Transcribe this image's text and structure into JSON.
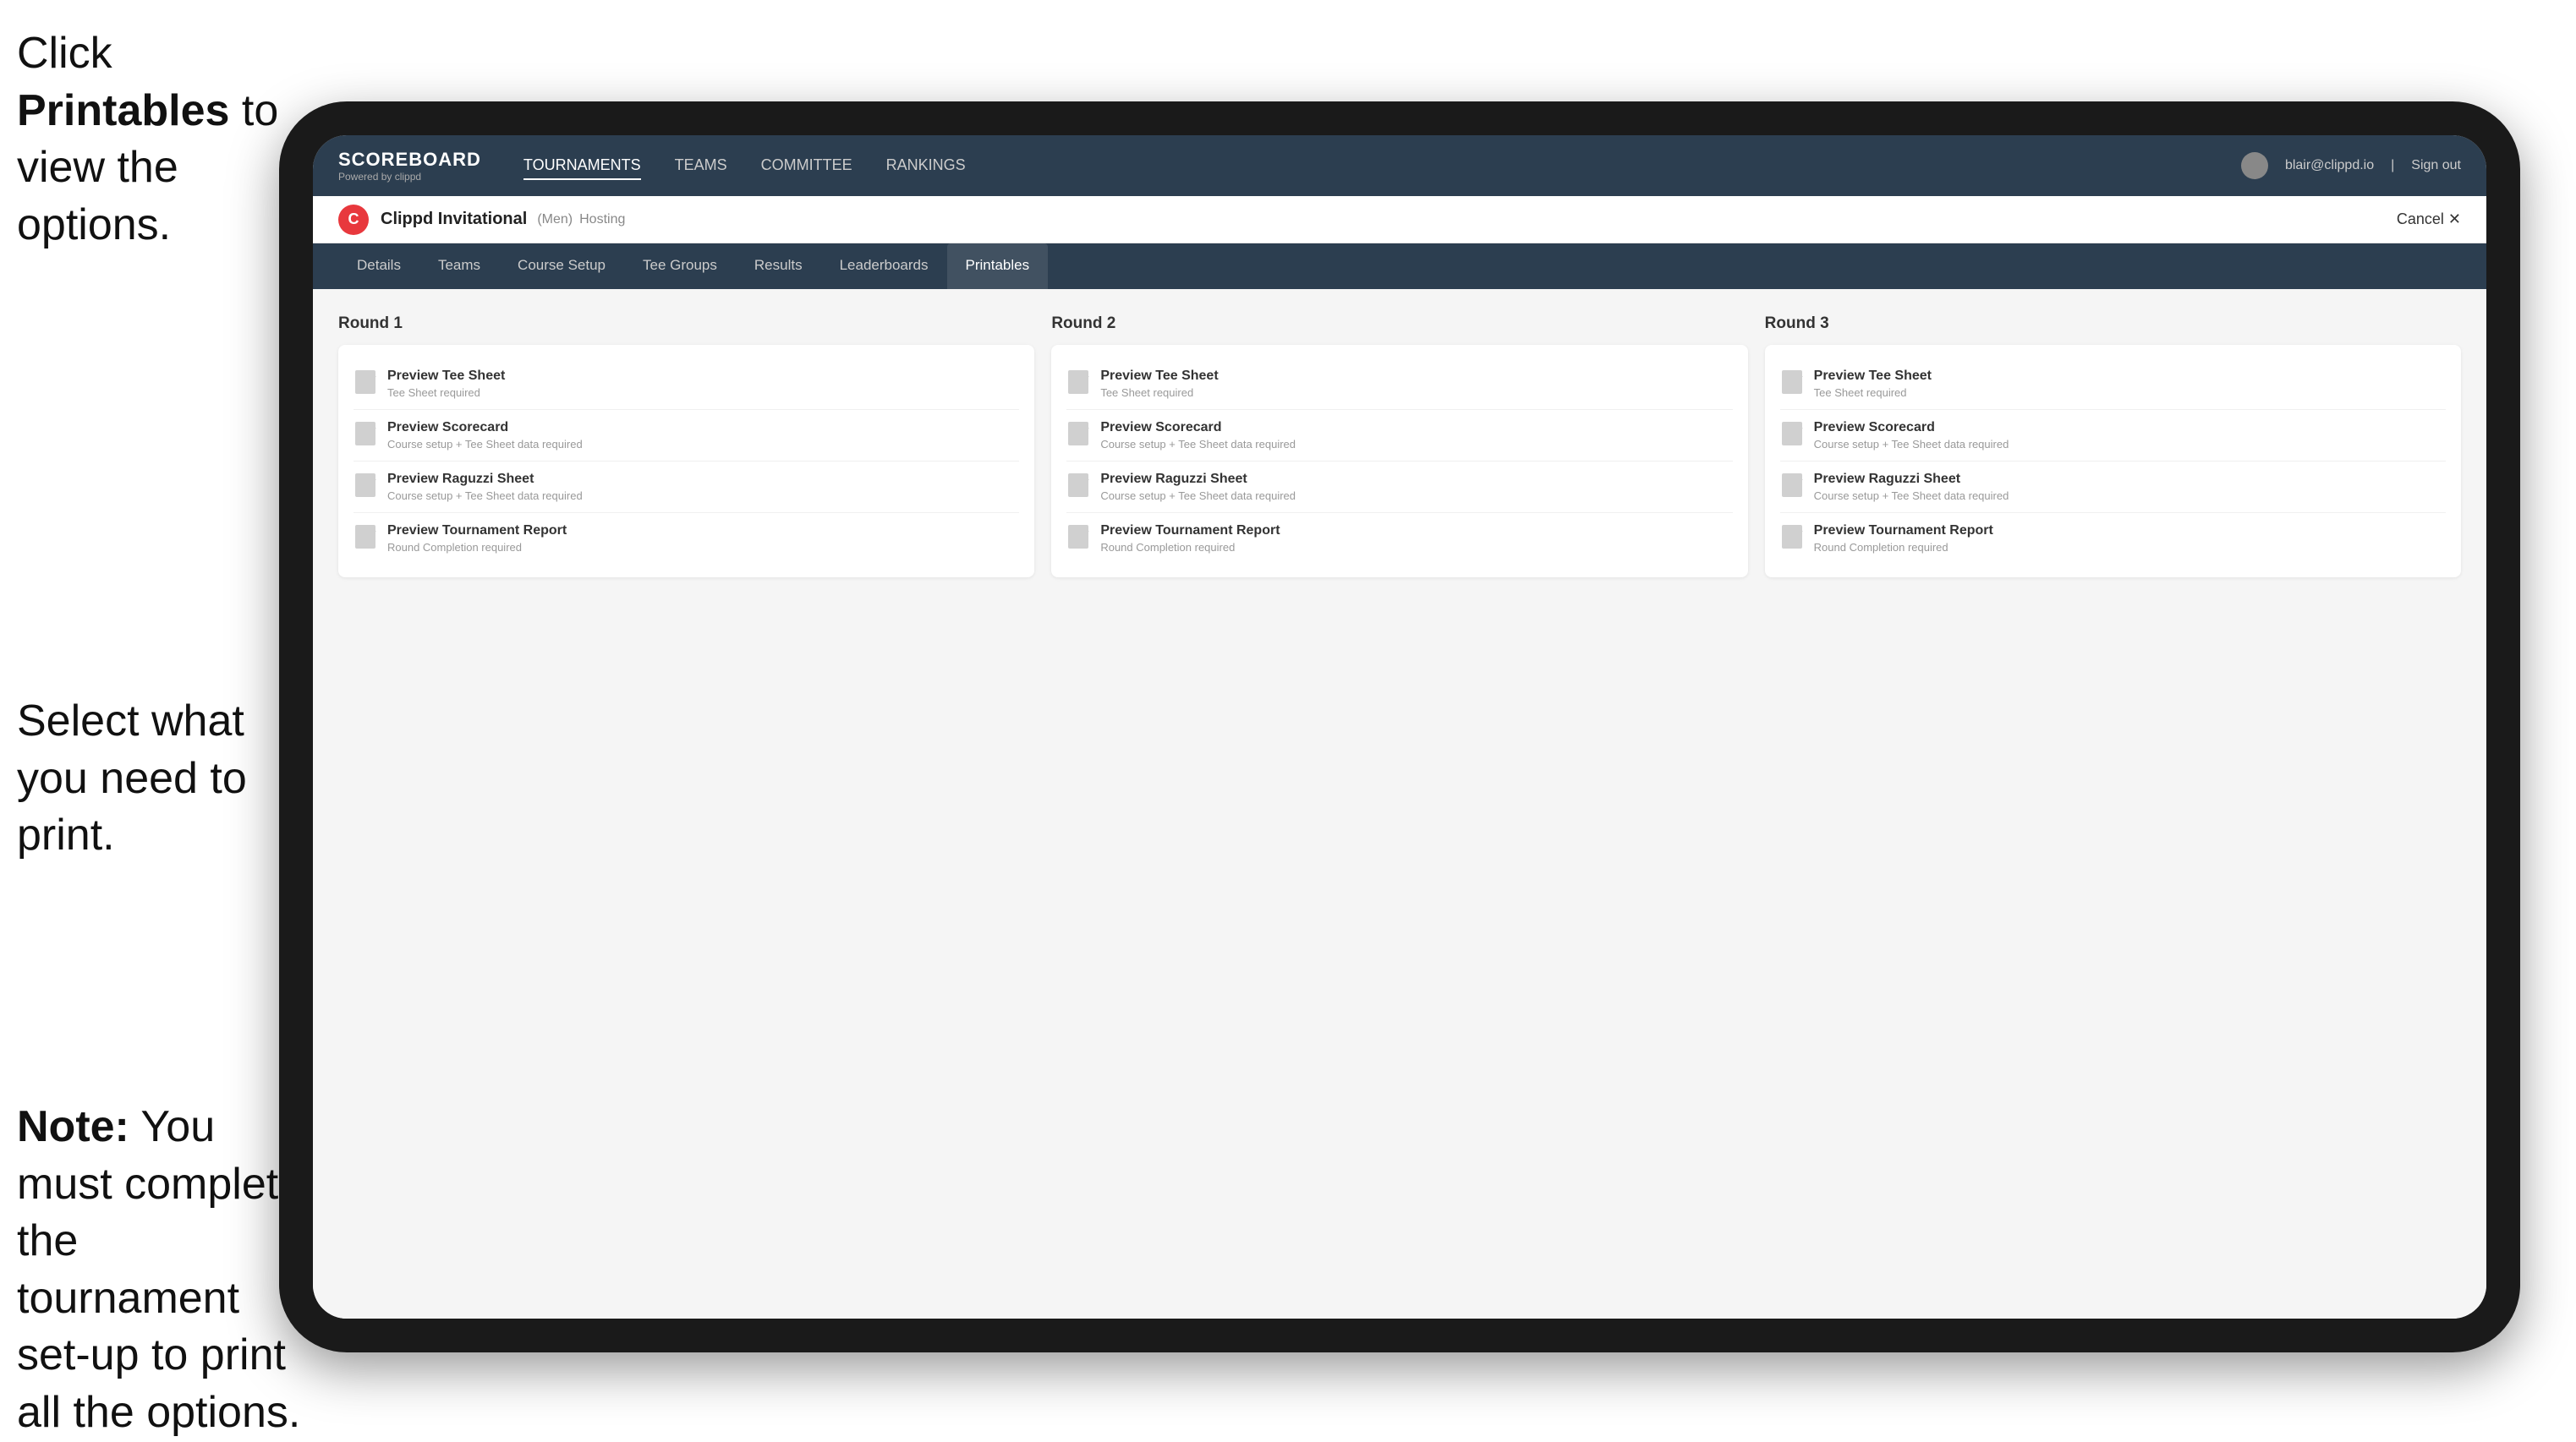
{
  "instructions": {
    "top_line1": "Click ",
    "top_bold": "Printables",
    "top_line2": " to",
    "top_line3": "view the options.",
    "middle_line1": "Select what you",
    "middle_line2": "need to print.",
    "bottom_line1": "Note:",
    "bottom_line2": " You must",
    "bottom_line3": "complete the",
    "bottom_line4": "tournament set-up",
    "bottom_line5": "to print all the options."
  },
  "nav": {
    "logo_title": "SCOREBOARD",
    "logo_sub": "Powered by clippd",
    "links": [
      {
        "label": "TOURNAMENTS",
        "active": false
      },
      {
        "label": "TEAMS",
        "active": false
      },
      {
        "label": "COMMITTEE",
        "active": false
      },
      {
        "label": "RANKINGS",
        "active": false
      }
    ],
    "user_email": "blair@clippd.io",
    "sign_out": "Sign out"
  },
  "tournament": {
    "logo_letter": "C",
    "name": "Clippd Invitational",
    "tag": "(Men)",
    "status": "Hosting",
    "cancel": "Cancel",
    "cancel_icon": "✕"
  },
  "sub_tabs": [
    {
      "label": "Details",
      "active": false
    },
    {
      "label": "Teams",
      "active": false
    },
    {
      "label": "Course Setup",
      "active": false
    },
    {
      "label": "Tee Groups",
      "active": false
    },
    {
      "label": "Results",
      "active": false
    },
    {
      "label": "Leaderboards",
      "active": false
    },
    {
      "label": "Printables",
      "active": true
    }
  ],
  "rounds": [
    {
      "title": "Round 1",
      "items": [
        {
          "title": "Preview Tee Sheet",
          "subtitle": "Tee Sheet required"
        },
        {
          "title": "Preview Scorecard",
          "subtitle": "Course setup + Tee Sheet data required"
        },
        {
          "title": "Preview Raguzzi Sheet",
          "subtitle": "Course setup + Tee Sheet data required"
        },
        {
          "title": "Preview Tournament Report",
          "subtitle": "Round Completion required"
        }
      ]
    },
    {
      "title": "Round 2",
      "items": [
        {
          "title": "Preview Tee Sheet",
          "subtitle": "Tee Sheet required"
        },
        {
          "title": "Preview Scorecard",
          "subtitle": "Course setup + Tee Sheet data required"
        },
        {
          "title": "Preview Raguzzi Sheet",
          "subtitle": "Course setup + Tee Sheet data required"
        },
        {
          "title": "Preview Tournament Report",
          "subtitle": "Round Completion required"
        }
      ]
    },
    {
      "title": "Round 3",
      "items": [
        {
          "title": "Preview Tee Sheet",
          "subtitle": "Tee Sheet required"
        },
        {
          "title": "Preview Scorecard",
          "subtitle": "Course setup + Tee Sheet data required"
        },
        {
          "title": "Preview Raguzzi Sheet",
          "subtitle": "Course setup + Tee Sheet data required"
        },
        {
          "title": "Preview Tournament Report",
          "subtitle": "Round Completion required"
        }
      ]
    }
  ]
}
